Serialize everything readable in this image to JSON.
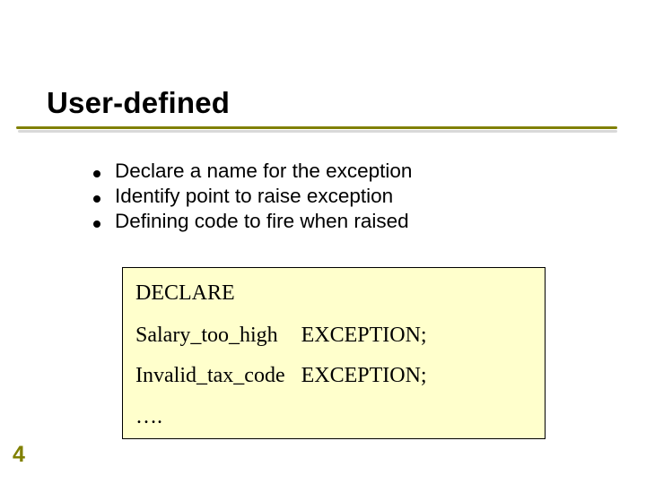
{
  "title": "User-defined",
  "bullets": [
    "Declare a name for the exception",
    "Identify point to raise exception",
    "Defining code to fire when raised"
  ],
  "code": {
    "keyword": "DECLARE",
    "rows": [
      {
        "name": "Salary_too_high",
        "type": "EXCEPTION;"
      },
      {
        "name": "Invalid_tax_code",
        "type": "EXCEPTION;"
      },
      {
        "name": "….",
        "type": ""
      }
    ]
  },
  "page_number": "4",
  "colors": {
    "accent": "#808000",
    "code_bg": "#ffffcc"
  }
}
